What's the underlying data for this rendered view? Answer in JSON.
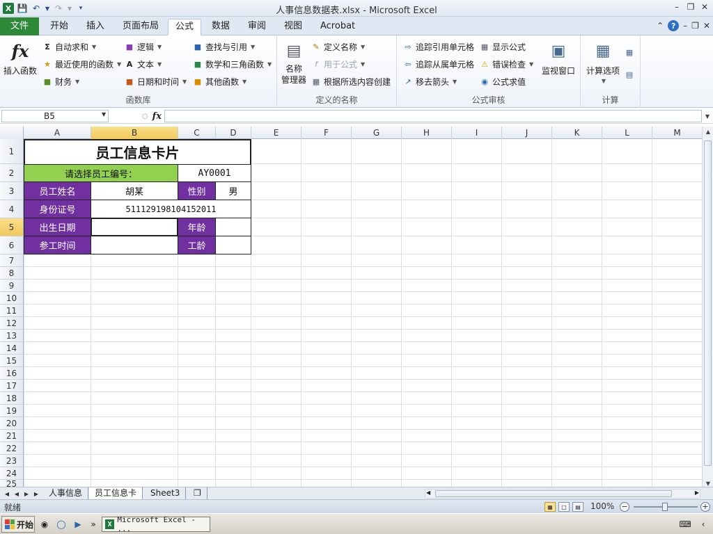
{
  "window": {
    "title": "人事信息数据表.xlsx - Microsoft Excel",
    "app_icon_letter": "X"
  },
  "tabs": [
    "文件",
    "开始",
    "插入",
    "页面布局",
    "公式",
    "数据",
    "审阅",
    "视图",
    "Acrobat"
  ],
  "ribbon": {
    "function_library": {
      "label": "函数库",
      "insert_function": "插入函数",
      "fx_glyph": "fx",
      "sigma_glyph": "Σ",
      "autosum": "自动求和",
      "recent": "最近使用的函数",
      "financial": "财务",
      "logical": "逻辑",
      "text": "文本",
      "datetime": "日期和时间",
      "lookup": "查找与引用",
      "math": "数学和三角函数",
      "other": "其他函数"
    },
    "defined_names": {
      "label": "定义的名称",
      "name_manager_1": "名称",
      "name_manager_2": "管理器",
      "define_name": "定义名称",
      "use_in_formula": "用于公式",
      "create_from_selection": "根据所选内容创建"
    },
    "formula_auditing": {
      "label": "公式审核",
      "trace_precedents": "追踪引用单元格",
      "trace_dependents": "追踪从属单元格",
      "remove_arrows": "移去箭头",
      "show_formulas": "显示公式",
      "error_checking": "错误检查",
      "evaluate_formula": "公式求值",
      "watch_window": "监视窗口"
    },
    "calculation": {
      "label": "计算",
      "calc_options": "计算选项"
    }
  },
  "formula_bar": {
    "name_box": "B5",
    "fx_label": "fx",
    "formula_value": ""
  },
  "columns": [
    "A",
    "B",
    "C",
    "D",
    "E",
    "F",
    "G",
    "H",
    "I",
    "J",
    "K",
    "L",
    "M"
  ],
  "rows": [
    "1",
    "2",
    "3",
    "4",
    "5",
    "6",
    "7",
    "8",
    "9",
    "10",
    "11",
    "12",
    "13",
    "14",
    "15",
    "16",
    "17",
    "18",
    "19",
    "20",
    "21",
    "22",
    "23",
    "24",
    "25"
  ],
  "card": {
    "title": "员工信息卡片",
    "select_prompt": "请选择员工编号：",
    "employee_id": "AY0001",
    "name_label": "员工姓名",
    "name_value": "胡某",
    "gender_label": "性别",
    "gender_value": "男",
    "id_label": "身份证号",
    "id_value": "511129198104152011",
    "birth_label": "出生日期",
    "birth_value": "",
    "age_label": "年龄",
    "age_value": "",
    "join_label": "参工时间",
    "join_value": "",
    "seniority_label": "工龄",
    "seniority_value": ""
  },
  "sheets": [
    "人事信息",
    "员工信息卡",
    "Sheet3"
  ],
  "active_sheet": "员工信息卡",
  "status": {
    "ready": "就绪",
    "zoom": "100%"
  },
  "taskbar": {
    "start": "开始",
    "task_label": "Microsoft Excel - ..."
  },
  "colors": {
    "purple": "#7030a0",
    "green": "#92d050",
    "file_tab": "#2d8838"
  }
}
